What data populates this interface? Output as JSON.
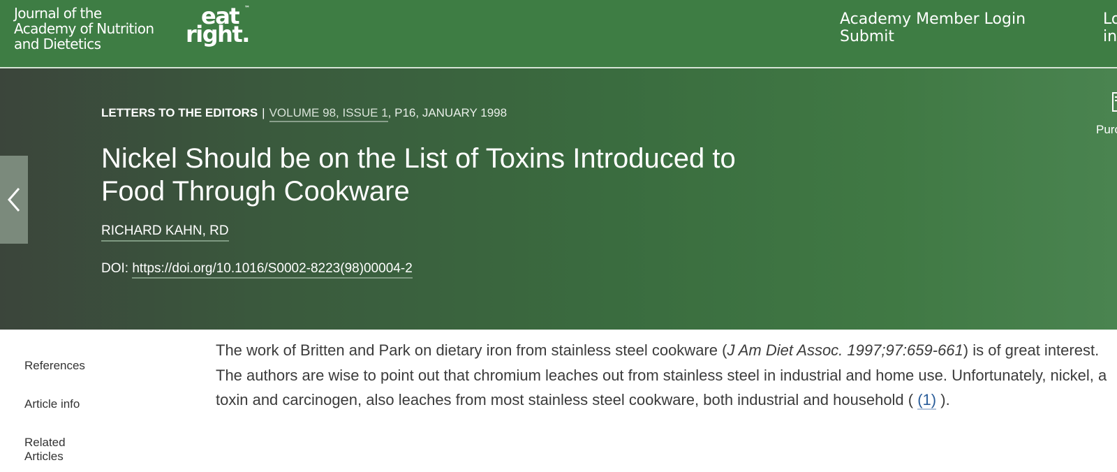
{
  "header": {
    "journal_name_lines": [
      "Journal of the",
      "Academy of Nutrition",
      "and Dietetics"
    ],
    "brand_logo_lines": [
      "eat",
      "right."
    ],
    "brand_logo_mark": "™",
    "links": [
      "Academy Member Login",
      "Submit"
    ],
    "cut_links": [
      "Lo",
      "in"
    ],
    "colors": {
      "bar": "#3e7d44",
      "text": "#ffffff"
    }
  },
  "article": {
    "section": "LETTERS TO THE EDITORS",
    "separator": "|",
    "volume_issue": "VOLUME 98, ISSUE 1",
    "page_date": ", P16, JANUARY 1998",
    "title": "Nickel Should be on the List of Toxins Introduced to Food Through Cookware",
    "author": "RICHARD KAHN, RD",
    "doi_label": "DOI:",
    "doi_url": "https://doi.org/10.1016/S0002-8223(98)00004-2",
    "prev_icon": "chevron-left-icon",
    "side_tool_label": "Purc",
    "side_tool_icon": "document-icon"
  },
  "nav": {
    "items": [
      "References",
      "Article info",
      "Related",
      "Articles"
    ]
  },
  "body": {
    "p1_a": "The work of Britten and Park on dietary iron from stainless steel cookware (",
    "p1_cite": "J Am Diet Assoc. 1997;97:659-661",
    "p1_b": ") is of great interest. The authors are wise to point out that chromium leaches out from stainless steel in industrial and home use. Unfortunately, nickel, a toxin and carcinogen, also leaches from most stainless steel cookware, both industrial and household ( ",
    "p1_ref": "(1)",
    "p1_c": " )."
  }
}
